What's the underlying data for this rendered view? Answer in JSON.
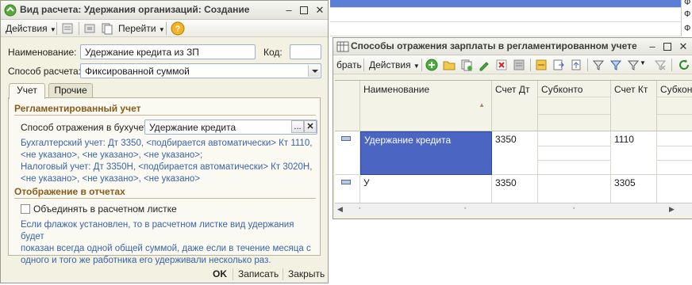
{
  "background": {
    "right_cells": [
      "Ф",
      "Ф",
      "Ф"
    ]
  },
  "dialog1": {
    "title": "Вид расчета: Удержания организаций: Создание",
    "toolbar": {
      "actions": "Действия",
      "goto": "Перейти"
    },
    "name_label": "Наименование:",
    "name_value": "Удержание кредита из ЗП",
    "code_label": "Код:",
    "code_value": "",
    "method_label": "Способ расчета:",
    "method_value": "Фиксированной суммой",
    "tabs": [
      "Учет",
      "Прочие"
    ],
    "section_reg": "Регламентированный учет",
    "reflect_label": "Способ отражения в бухучете:",
    "reflect_value": "Удержание кредита",
    "ellipsis": "...",
    "info_lines": [
      "Бухгалтерский учет: Дт 3350, <подбирается автоматически> Кт 1110,",
      "<не указано>, <не указано>, <не указано>;",
      "Налоговый учет: Дт 3350Н, <подбирается автоматически> Кт 3020Н,",
      "<не указано>, <не указано>, <не указано>"
    ],
    "section_reports": "Отображение в отчетах",
    "checkbox_label": "Объединять в расчетном листке",
    "checkbox_checked": false,
    "note_lines": [
      "Если флажок установлен, то в расчетном листке вид удержания будет",
      "показан всегда одной общей суммой, даже если в течение месяца с",
      "одного и того же работника его удерживали несколько раз."
    ],
    "buttons": {
      "ok": "OK",
      "save": "Записать",
      "close": "Закрыть"
    }
  },
  "dialog2": {
    "title": "Способы отражения зарплаты в регламентированном учете",
    "toolbar": {
      "select": "брать",
      "actions": "Действия"
    },
    "columns": [
      "Наименование",
      "Счет Дт",
      "Субконто",
      "Счет Кт",
      "Субконто"
    ],
    "rows": [
      {
        "name": "Удержание кредита",
        "dt": "3350",
        "kt": "1110",
        "selected": true
      },
      {
        "name": "У",
        "dt": "3350",
        "kt": "3305",
        "selected": false
      }
    ]
  },
  "colors": {
    "window_bg": "#f3f1e2",
    "section_title": "#8a5a1a",
    "info_text": "#3a63a8",
    "selection": "#4a66c2",
    "top_blue_line": "#5b7fd6"
  }
}
